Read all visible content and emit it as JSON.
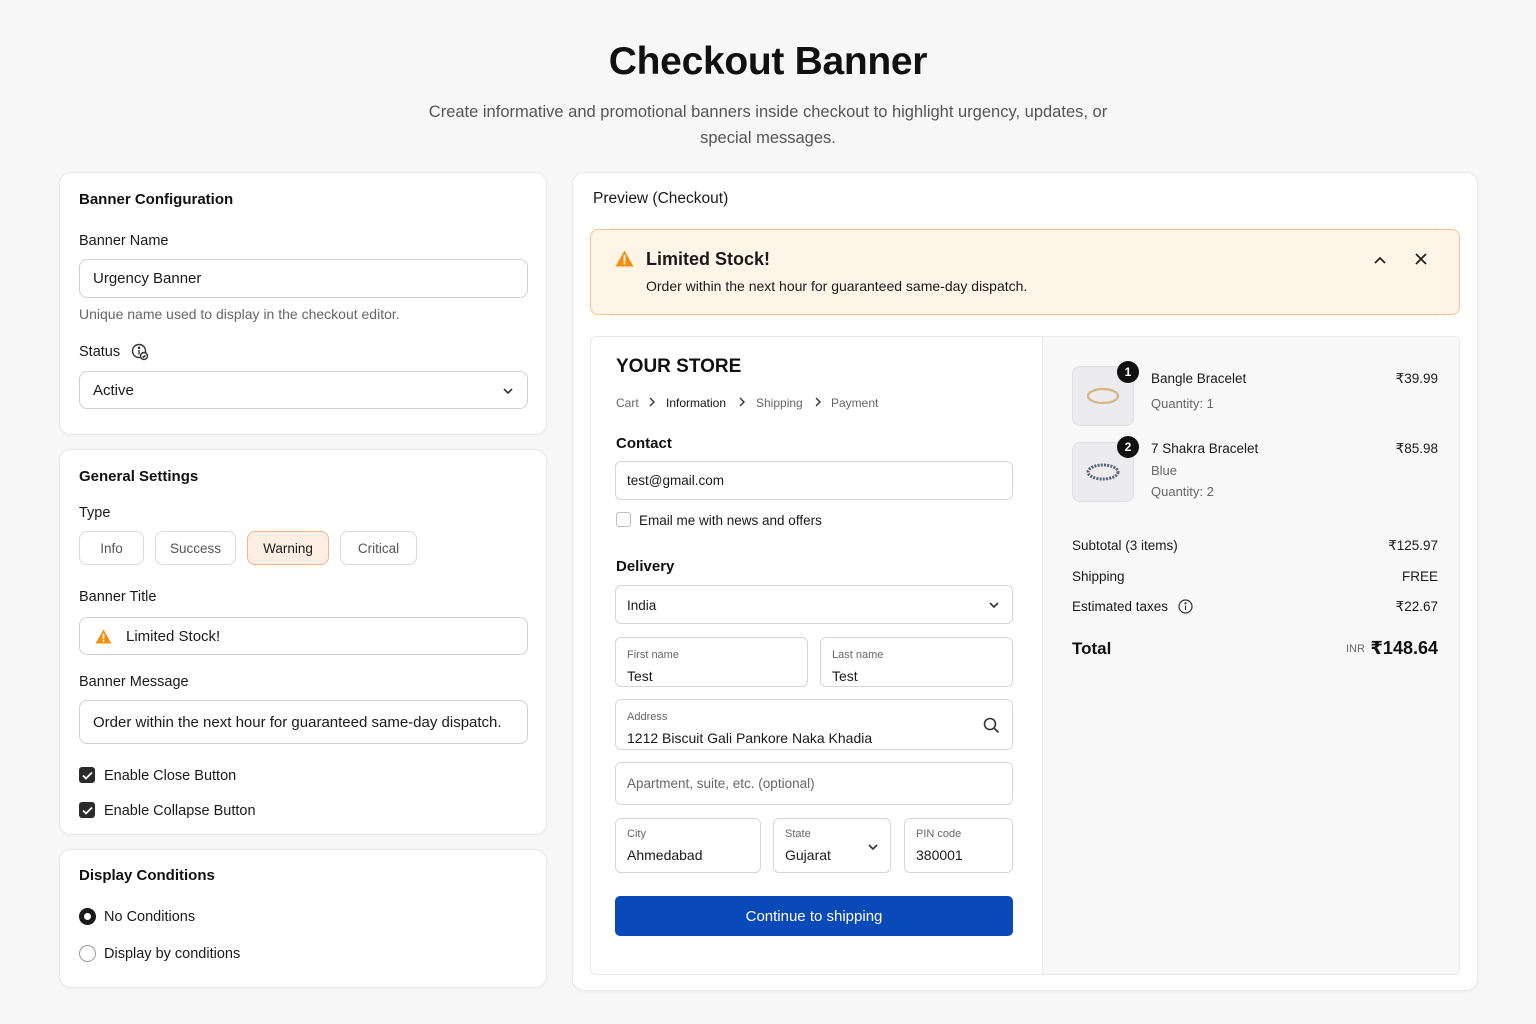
{
  "header": {
    "title": "Checkout Banner",
    "subtitle": "Create informative and promotional banners inside checkout to highlight urgency, updates, or special messages."
  },
  "config": {
    "title": "Banner Configuration",
    "name_label": "Banner Name",
    "name_value": "Urgency Banner",
    "name_help": "Unique name used to display in the checkout editor.",
    "status_label": "Status",
    "status_value": "Active"
  },
  "general": {
    "title": "General Settings",
    "type_label": "Type",
    "types": [
      "Info",
      "Success",
      "Warning",
      "Critical"
    ],
    "selected_type": "Warning",
    "banner_title_label": "Banner Title",
    "banner_title_value": "Limited Stock!",
    "banner_message_label": "Banner Message",
    "banner_message_value": "Order within the next hour for guaranteed same-day dispatch.",
    "close_label": "Enable Close Button",
    "collapse_label": "Enable Collapse Button"
  },
  "display": {
    "title": "Display Conditions",
    "options": [
      "No Conditions",
      "Display by conditions"
    ],
    "selected": "No Conditions"
  },
  "preview": {
    "title": "Preview (Checkout)",
    "banner_title": "Limited Stock!",
    "banner_message": "Order within the next hour for guaranteed same-day dispatch.",
    "warning_color": "#f0900f",
    "store_name": "YOUR STORE",
    "breadcrumb": [
      "Cart",
      "Information",
      "Shipping",
      "Payment"
    ],
    "contact_title": "Contact",
    "email": "test@gmail.com",
    "news_label": "Email me with news and offers",
    "delivery_title": "Delivery",
    "country": "India",
    "first_name_label": "First name",
    "first_name": "Test",
    "last_name_label": "Last name",
    "last_name": "Test",
    "address_label": "Address",
    "address": "1212 Biscuit Gali Pankore Naka Khadia",
    "apartment_placeholder": "Apartment, suite, etc. (optional)",
    "city_label": "City",
    "city": "Ahmedabad",
    "state_label": "State",
    "state": "Gujarat",
    "pin_label": "PIN code",
    "pin": "380001",
    "continue_label": "Continue to shipping",
    "button_color": "#0a49b8"
  },
  "summary": {
    "items": [
      {
        "badge": "1",
        "name": "Bangle Bracelet",
        "variant": "",
        "qty": "Quantity: 1",
        "price": "₹39.99"
      },
      {
        "badge": "2",
        "name": "7 Shakra Bracelet",
        "variant": "Blue",
        "qty": "Quantity: 2",
        "price": "₹85.98"
      }
    ],
    "subtotal_label": "Subtotal (3 items)",
    "subtotal": "₹125.97",
    "shipping_label": "Shipping",
    "shipping": "FREE",
    "taxes_label": "Estimated taxes",
    "taxes": "₹22.67",
    "total_label": "Total",
    "currency": "INR",
    "total": "₹148.64"
  }
}
